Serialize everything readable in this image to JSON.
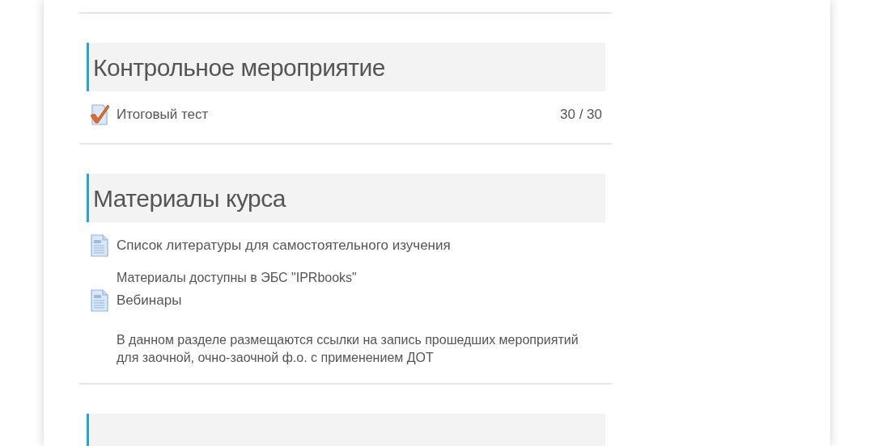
{
  "sections": [
    {
      "title": "Контрольное мероприятие",
      "items": [
        {
          "kind": "quiz",
          "label": "Итоговый тест",
          "score": "30 / 30"
        }
      ]
    },
    {
      "title": "Материалы курса",
      "items": [
        {
          "kind": "page",
          "label": "Список литературы для самостоятельного изучения",
          "description": "Материалы доступны в ЭБС \"IPRbooks\""
        },
        {
          "kind": "page",
          "label": "Вебинары",
          "description": "В данном разделе размещаются ссылки на запись прошедших мероприятий для заочной, очно-заочной ф.о. с применением ДОТ"
        }
      ]
    }
  ]
}
